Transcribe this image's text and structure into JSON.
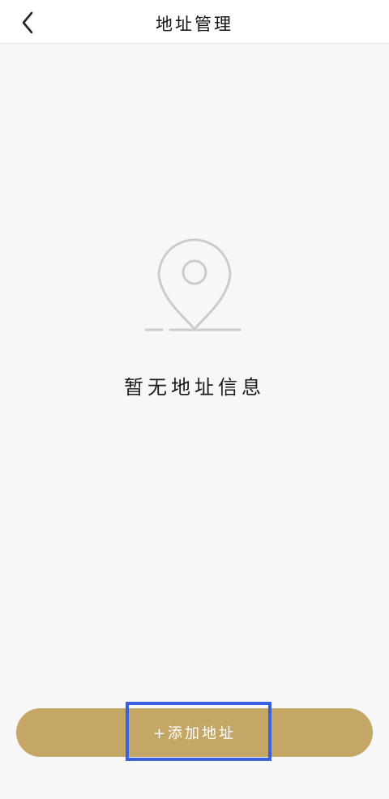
{
  "header": {
    "title": "地址管理",
    "back_icon": "chevron-left-icon"
  },
  "empty_state": {
    "icon": "location-pin-icon",
    "message": "暂无地址信息"
  },
  "footer": {
    "add_button_label": "+添加地址"
  },
  "colors": {
    "page_background": "#f7f7f7",
    "header_background": "#ffffff",
    "accent_gold": "#c4a766",
    "icon_gray": "#cccccc",
    "highlight_blue": "#3a5fe0"
  }
}
